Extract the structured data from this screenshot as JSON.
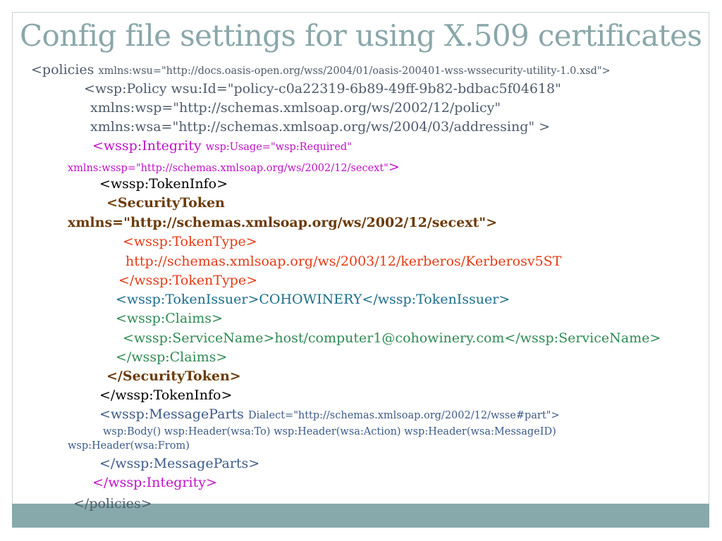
{
  "slide": {
    "title": "Config file settings for using X.509 certificates"
  },
  "code": {
    "l01_tag": "<policies",
    "l01_attr": "xmlns:wsu=\"http://docs.oasis-open.org/wss/2004/01/oasis-200401-wss-wssecurity-utility-1.0.xsd\">",
    "l02": "<wsp:Policy wsu:Id=\"policy-c0a22319-6b89-49ff-9b82-bdbac5f04618\"",
    "l03": "xmlns:wsp=\"http://schemas.xmlsoap.org/ws/2002/12/policy\"",
    "l04": "xmlns:wsa=\"http://schemas.xmlsoap.org/ws/2004/03/addressing\" >",
    "l05_tag": "<wssp:Integrity",
    "l05_attr": "wsp:Usage=\"wsp:Required\"",
    "l06_attr": "xmlns:wssp=\"http://schemas.xmlsoap.org/ws/2002/12/secext\"",
    "l06_end": ">",
    "l07": "<wssp:TokenInfo>",
    "l08": "<SecurityToken",
    "l09": "xmlns=\"http://schemas.xmlsoap.org/ws/2002/12/secext\">",
    "l10": "<wssp:TokenType>",
    "l11": "http://schemas.xmlsoap.org/ws/2003/12/kerberos/Kerberosv5ST",
    "l12": "</wssp:TokenType>",
    "l13": "<wssp:TokenIssuer>COHOWINERY</wssp:TokenIssuer>",
    "l14": "<wssp:Claims>",
    "l15": "<wssp:ServiceName>host/computer1@cohowinery.com</wssp:ServiceName>",
    "l16": "</wssp:Claims>",
    "l17": "</SecurityToken>",
    "l18": "</wssp:TokenInfo>",
    "l19_tag": "<wssp:MessageParts",
    "l19_attr": "Dialect=\"http://schemas.xmlsoap.org/2002/12/wsse#part\">",
    "l20": "wsp:Body() wsp:Header(wsa:To) wsp:Header(wsa:Action) wsp:Header(wsa:MessageID)",
    "l21": "wsp:Header(wsa:From)",
    "l22": "</wssp:MessageParts>",
    "l23": "</wssp:Integrity>",
    "l24": "</policies>"
  },
  "colors": {
    "title": "#8aa7aa",
    "band": "#88a9ab",
    "slate": "#4e5b6b",
    "magenta": "#c012c8",
    "brown": "#6b3a08",
    "red": "#e53a15",
    "teal": "#1b6e8a",
    "green": "#2e8a52",
    "blue": "#3b5b88"
  }
}
